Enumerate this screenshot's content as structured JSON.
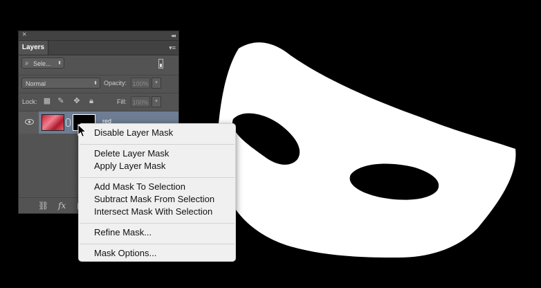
{
  "layers_panel": {
    "close_glyph": "×",
    "collapse_glyph": "◂◂",
    "tab_label": "Layers",
    "menu_glyph": "▾≡",
    "filter": {
      "label": "Sele...",
      "icon": "search-icon"
    },
    "blend_mode": "Normal",
    "opacity_label": "Opacity:",
    "opacity_value": "100%",
    "lock_label": "Lock:",
    "fill_label": "Fill:",
    "fill_value": "100%",
    "layer": {
      "name": "red",
      "visible": true,
      "has_mask": true
    },
    "footer_icons": [
      "link-icon",
      "fx-icon",
      "mask-icon"
    ],
    "fx_label": "fx"
  },
  "context_menu": {
    "items": [
      "Disable Layer Mask",
      "Delete Layer Mask",
      "Apply Layer Mask",
      "Add Mask To Selection",
      "Subtract Mask From Selection",
      "Intersect Mask With Selection",
      "Refine Mask...",
      "Mask Options..."
    ]
  },
  "colors": {
    "canvas_bg": "#000000",
    "mask_fill": "#ffffff",
    "panel_bg": "#535353",
    "selected_layer": "#6e7d93",
    "menu_bg": "#f0f0f0"
  }
}
